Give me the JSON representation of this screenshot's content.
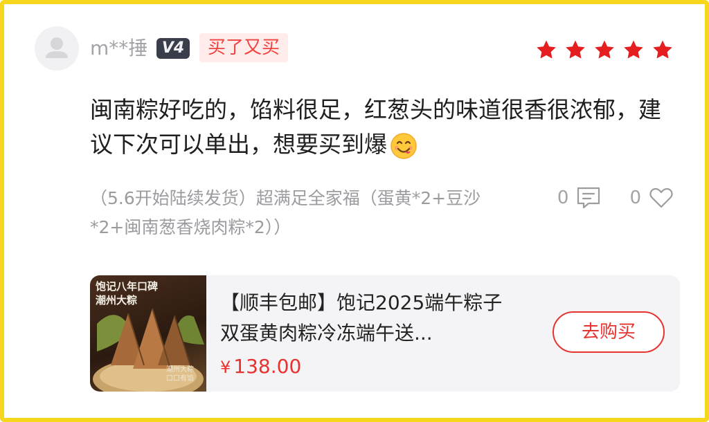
{
  "user": {
    "name": "m**捶",
    "level": "V4",
    "badge": "买了又买",
    "rating_stars": 5,
    "star_color": "#e51f1f"
  },
  "review": {
    "text": "闽南粽好吃的，馅料很足，红葱头的味道很香很浓郁，建议下次可以单出，想要买到爆",
    "emoji": "yum-face-emoji"
  },
  "sku": {
    "text": "（5.6开始陆续发货）超满足全家福（蛋黄*2+豆沙*2+闽南葱香烧肉粽*2））"
  },
  "actions": {
    "comment_count": "0",
    "like_count": "0"
  },
  "product": {
    "thumb_title": "饱记八年口碑\n潮州大粽",
    "thumb_tag": "潮州大粽\n口口有馅",
    "title": "【顺丰包邮】饱记2025端午粽子双蛋黄肉粽冷冻端午送...",
    "currency": "¥",
    "price": "138.00",
    "buy_label": "去购买",
    "accent_color": "#e8322f"
  }
}
